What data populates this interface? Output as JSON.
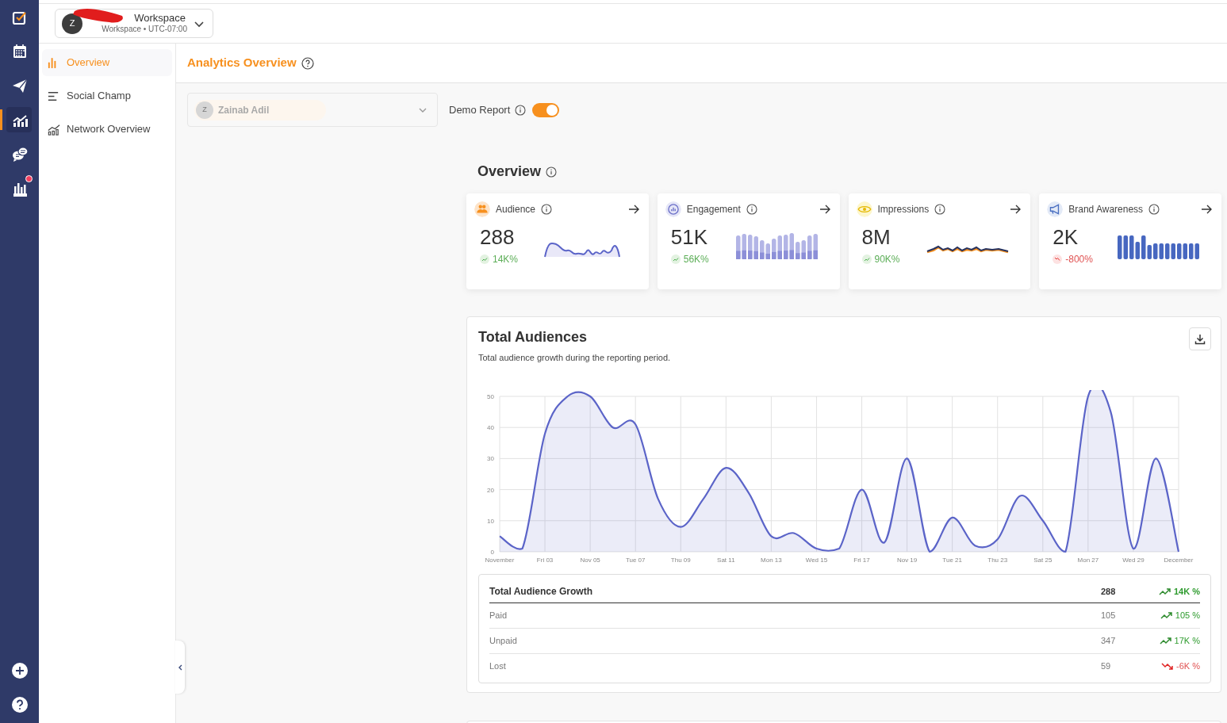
{
  "rail": [
    {
      "selected": false,
      "badge": false
    },
    {
      "selected": false,
      "badge": false
    },
    {
      "selected": false,
      "badge": false
    },
    {
      "selected": true,
      "badge": false
    },
    {
      "selected": false,
      "badge": false
    },
    {
      "selected": false,
      "badge": true
    }
  ],
  "workspace": {
    "avatar": "Z",
    "name": "Workspace",
    "subtitle": "Workspace • UTC-07:00"
  },
  "sidebar": {
    "items": [
      {
        "label": "Overview",
        "selected": true
      },
      {
        "label": "Social Champ",
        "selected": false
      },
      {
        "label": "Network Overview",
        "selected": false
      }
    ]
  },
  "page_title": "Analytics Overview",
  "account_select": {
    "avatar": "Z",
    "value": "Zainab Adil",
    "disabled": true
  },
  "demo_report": {
    "label": "Demo Report",
    "on": true
  },
  "overview": {
    "title": "Overview",
    "cards": [
      {
        "label": "Audience",
        "value": "288",
        "change": "14K%",
        "rising": true,
        "kind": "wave"
      },
      {
        "label": "Engagement",
        "value": "51K",
        "change": "56K%",
        "rising": true,
        "kind": "soft-bars"
      },
      {
        "label": "Impressions",
        "value": "8M",
        "change": "90K%",
        "rising": true,
        "kind": "dual-line"
      },
      {
        "label": "Brand Awareness",
        "value": "2K",
        "change": "-800%",
        "rising": false,
        "kind": "bars"
      }
    ]
  },
  "total_audiences": {
    "title": "Total Audiences",
    "subtitle": "Total audience growth during the reporting period.",
    "chart_data": {
      "type": "area",
      "categories": [
        "November",
        null,
        "Fri 03",
        null,
        "Nov 05",
        null,
        "Tue 07",
        null,
        "Thu 09",
        null,
        "Sat 11",
        null,
        "Mon 13",
        null,
        "Wed 15",
        null,
        "Fri 17",
        null,
        "Nov 19",
        null,
        "Tue 21",
        null,
        "Thu 23",
        null,
        "Sat 25",
        null,
        "Mon 27",
        null,
        "Wed 29",
        null,
        "December"
      ],
      "series": [
        {
          "color": "#5b64c8",
          "values": [
            5,
            1,
            38,
            50,
            50,
            40,
            41,
            17,
            8,
            17,
            27,
            19,
            5,
            6,
            1,
            1,
            20,
            3,
            30,
            0,
            11,
            2,
            4,
            18,
            10,
            0,
            50,
            45,
            1,
            30,
            0
          ]
        }
      ],
      "ylim": [
        0,
        50
      ],
      "grid": true,
      "yticks": [
        0,
        10,
        20,
        30,
        40,
        50
      ]
    },
    "table": [
      {
        "kind": "total",
        "label": "Total Audience Growth",
        "value": "288",
        "change": "14K %",
        "rising": true
      },
      {
        "kind": "row",
        "label": "Paid",
        "value": "105",
        "change": "105 %",
        "rising": true
      },
      {
        "kind": "row",
        "label": "Unpaid",
        "value": "347",
        "change": "17K %",
        "rising": true
      },
      {
        "kind": "row",
        "label": "Lost",
        "value": "59",
        "change": "-6K %",
        "rising": false
      }
    ]
  }
}
